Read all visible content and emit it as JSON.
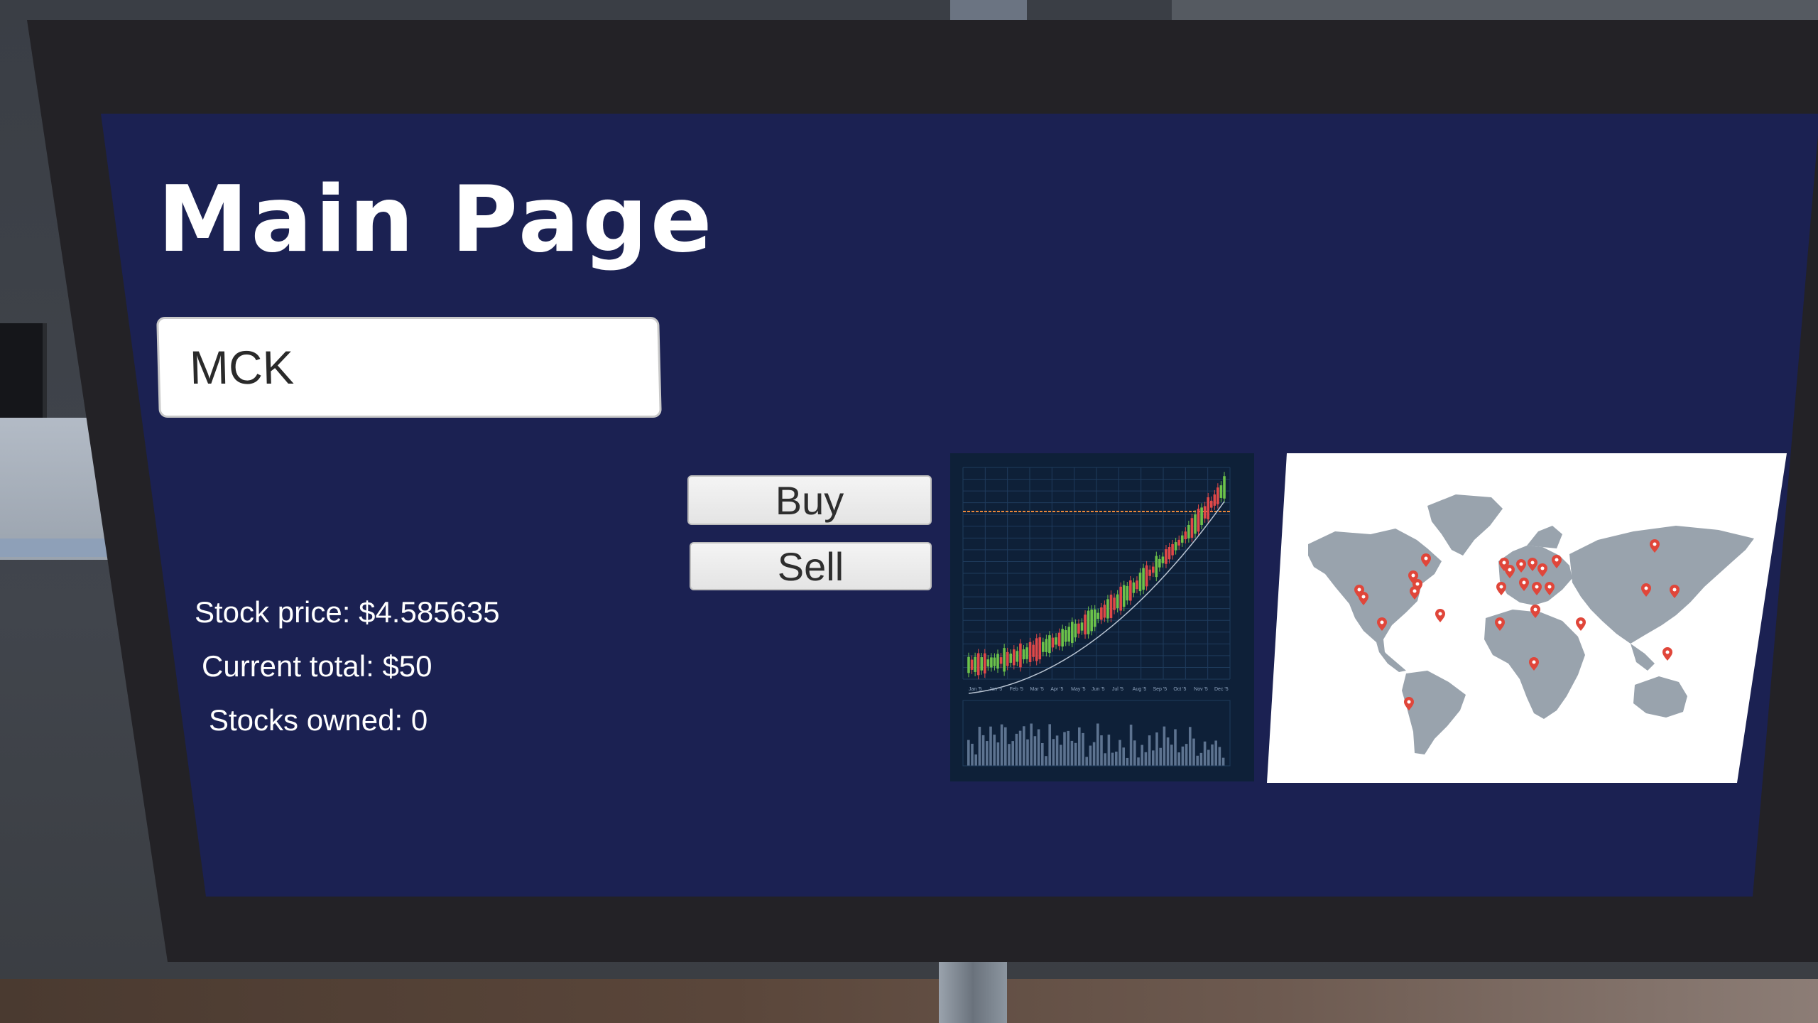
{
  "screen": {
    "title": "Main Page",
    "ticker_input": {
      "value": "MCK",
      "placeholder": ""
    },
    "buttons": {
      "buy_label": "Buy",
      "sell_label": "Sell"
    },
    "stats": {
      "price": "Stock price: $4.585635",
      "total": "Current total: $50",
      "owned": "Stocks owned: 0"
    },
    "images": {
      "chart": "stock-chart-image",
      "map": "world-map-image"
    }
  },
  "colors": {
    "screen_background": "#1b2152",
    "monitor_bezel": "#232226",
    "map_land": "#99a3ad",
    "map_pin": "#e0463a",
    "candle_up": "#6cc24a",
    "candle_down": "#e04848",
    "chart_background": "#0e2038"
  },
  "chart_data": {
    "type": "candlestick",
    "title": "",
    "xlabel": "",
    "ylabel": "",
    "x_tick_labels": [
      "Jan '5",
      "Jan '5",
      "Feb '5",
      "Mar '5",
      "Apr '5",
      "May '5",
      "Jun '5",
      "Jul '5",
      "Aug '5",
      "Sep '5",
      "Oct '5",
      "Nov '5",
      "Dec '5"
    ],
    "grid": true,
    "trend": "rising",
    "volume_panel": true
  }
}
